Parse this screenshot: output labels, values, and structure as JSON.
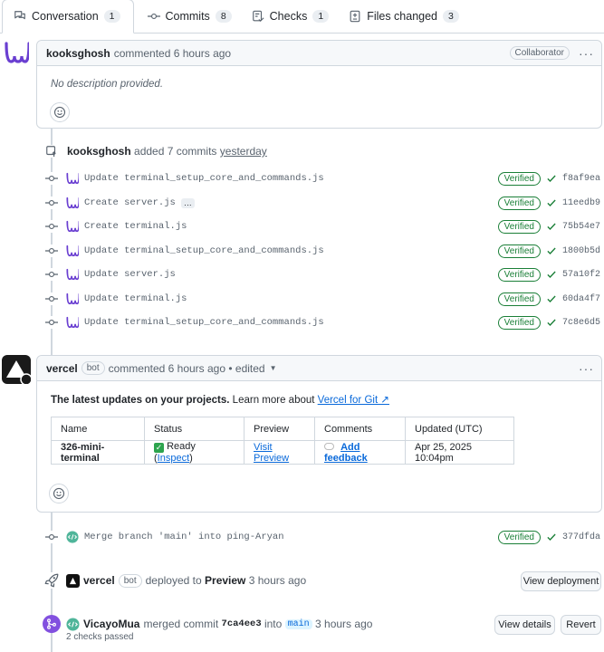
{
  "tabs": [
    {
      "label": "Conversation",
      "count": "1"
    },
    {
      "label": "Commits",
      "count": "8"
    },
    {
      "label": "Checks",
      "count": "1"
    },
    {
      "label": "Files changed",
      "count": "3"
    }
  ],
  "first_comment": {
    "author": "kooksghosh",
    "meta": "commented 6 hours ago",
    "role": "Collaborator",
    "body": "No description provided."
  },
  "commit_group": {
    "author": "kooksghosh",
    "text": "added 7 commits",
    "when": "yesterday"
  },
  "commits": [
    {
      "message": "Update terminal_setup_core_and_commands.js",
      "sha": "f8af9ea",
      "verified": "Verified",
      "more": ""
    },
    {
      "message": "Create server.js",
      "sha": "11eedb9",
      "verified": "Verified",
      "more": "…"
    },
    {
      "message": "Create terminal.js",
      "sha": "75b54e7",
      "verified": "Verified",
      "more": ""
    },
    {
      "message": "Update terminal_setup_core_and_commands.js",
      "sha": "1800b5d",
      "verified": "Verified",
      "more": ""
    },
    {
      "message": "Update server.js",
      "sha": "57a10f2",
      "verified": "Verified",
      "more": ""
    },
    {
      "message": "Update terminal.js",
      "sha": "60da4f7",
      "verified": "Verified",
      "more": ""
    },
    {
      "message": "Update terminal_setup_core_and_commands.js",
      "sha": "7c8e6d5",
      "verified": "Verified",
      "more": ""
    }
  ],
  "vercel_comment": {
    "author": "vercel",
    "bot": "bot",
    "meta": "commented 6 hours ago • edited",
    "intro_bold": "The latest updates on your projects.",
    "intro_rest": "Learn more about",
    "intro_link": "Vercel for Git ↗",
    "table": {
      "headers": [
        "Name",
        "Status",
        "Preview",
        "Comments",
        "Updated (UTC)"
      ],
      "row": {
        "name": "326-mini-terminal",
        "status": "Ready",
        "inspect": "Inspect",
        "preview": "Visit Preview",
        "comments": "Add feedback",
        "updated": "Apr 25, 2025 10:04pm"
      }
    }
  },
  "merge_commit": {
    "message": "Merge branch 'main' into ping-Aryan",
    "sha": "377dfda",
    "verified": "Verified"
  },
  "deploy_event": {
    "author": "vercel",
    "bot": "bot",
    "text": "deployed to",
    "target": "Preview",
    "when": "3 hours ago",
    "button": "View deployment"
  },
  "merge_event": {
    "author": "VicayoMua",
    "text": "merged commit",
    "commit": "7ca4ee3",
    "into": "into",
    "branch": "main",
    "when": "3 hours ago",
    "checks": "2 checks passed",
    "details_button": "View details",
    "revert_button": "Revert"
  },
  "colors": {
    "accent": "#0969da",
    "success": "#1a7f37",
    "merged": "#8250df",
    "border": "#d0d7de"
  }
}
